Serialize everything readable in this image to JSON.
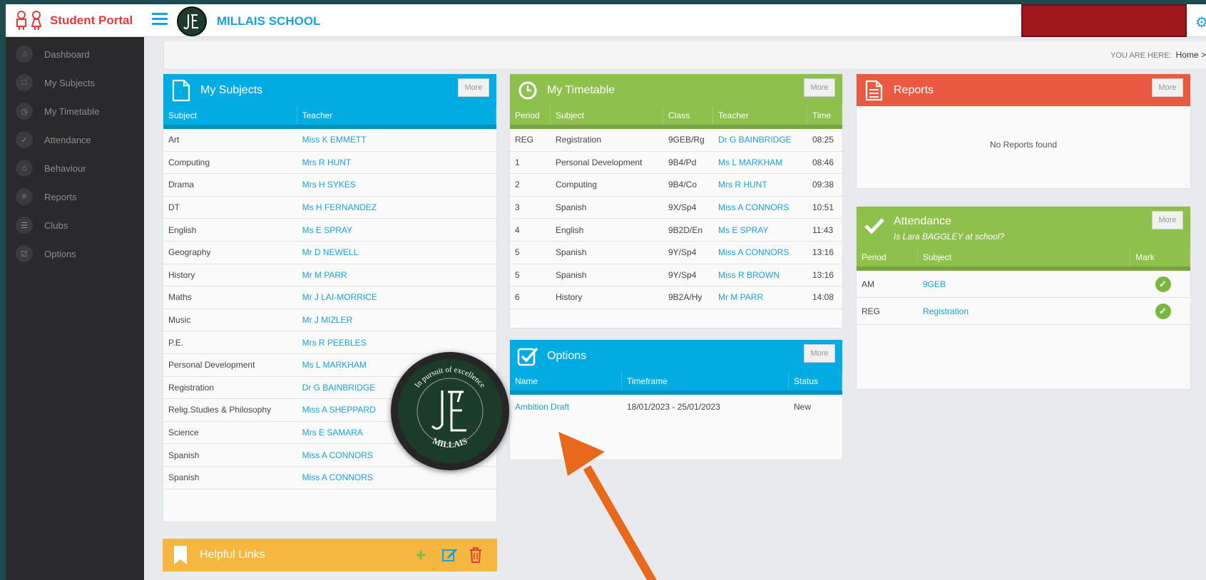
{
  "brand": {
    "title": "Student Portal"
  },
  "school": {
    "name": "MILLAIS SCHOOL"
  },
  "sidebar": {
    "items": [
      {
        "label": "Dashboard",
        "icon": "home-icon"
      },
      {
        "label": "My Subjects",
        "icon": "file-icon"
      },
      {
        "label": "My Timetable",
        "icon": "clock-icon"
      },
      {
        "label": "Attendance",
        "icon": "check-icon"
      },
      {
        "label": "Behaviour",
        "icon": "graduation-cap-icon"
      },
      {
        "label": "Reports",
        "icon": "document-icon"
      },
      {
        "label": "Clubs",
        "icon": "list-icon"
      },
      {
        "label": "Options",
        "icon": "checkbox-icon"
      }
    ]
  },
  "breadcrumb": {
    "prefix": "YOU ARE HERE:",
    "home": "Home >"
  },
  "subjects": {
    "title": "My Subjects",
    "more": "More",
    "columns": [
      "Subject",
      "Teacher"
    ],
    "rows": [
      [
        "Art",
        "Miss K EMMETT"
      ],
      [
        "Computing",
        "Mrs R HUNT"
      ],
      [
        "Drama",
        "Mrs H SYKES"
      ],
      [
        "DT",
        "Ms H FERNANDEZ"
      ],
      [
        "English",
        "Ms E SPRAY"
      ],
      [
        "Geography",
        "Mr D NEWELL"
      ],
      [
        "History",
        "Mr M PARR"
      ],
      [
        "Maths",
        "Mr J LAI-MORRICE"
      ],
      [
        "Music",
        "Mr J MIZLER"
      ],
      [
        "P.E.",
        "Mrs R PEEBLES"
      ],
      [
        "Personal Development",
        "Ms L MARKHAM"
      ],
      [
        "Registration",
        "Dr G BAINBRIDGE"
      ],
      [
        "Relig.Studies & Philosophy",
        "Miss A SHEPPARD"
      ],
      [
        "Science",
        "Mrs E SAMARA"
      ],
      [
        "Spanish",
        "Miss A CONNORS"
      ],
      [
        "Spanish",
        "Miss A CONNORS"
      ]
    ]
  },
  "timetable": {
    "title": "My Timetable",
    "more": "More",
    "columns": [
      "Period",
      "Subject",
      "Class",
      "Teacher",
      "Time"
    ],
    "rows": [
      [
        "REG",
        "Registration",
        "9GEB/Rg",
        "Dr G BAINBRIDGE",
        "08:25"
      ],
      [
        "1",
        "Personal Development",
        "9B4/Pd",
        "Ms L MARKHAM",
        "08:46"
      ],
      [
        "2",
        "Computing",
        "9B4/Co",
        "Mrs R HUNT",
        "09:38"
      ],
      [
        "3",
        "Spanish",
        "9X/Sp4",
        "Miss A CONNORS",
        "10:51"
      ],
      [
        "4",
        "English",
        "9B2D/En",
        "Ms E SPRAY",
        "11:43"
      ],
      [
        "5",
        "Spanish",
        "9Y/Sp4",
        "Miss A CONNORS",
        "13:16"
      ],
      [
        "5",
        "Spanish",
        "9Y/Sp4",
        "Miss R BROWN",
        "13:16"
      ],
      [
        "6",
        "History",
        "9B2A/Hy",
        "Mr M PARR",
        "14:08"
      ]
    ]
  },
  "options": {
    "title": "Options",
    "more": "More",
    "columns": [
      "Name",
      "Timeframe",
      "Status"
    ],
    "rows": [
      [
        "Ambition Draft",
        "18/01/2023 - 25/01/2023",
        "New"
      ]
    ]
  },
  "reports": {
    "title": "Reports",
    "more": "More",
    "empty": "No Reports found"
  },
  "attendance": {
    "title": "Attendance",
    "more": "More",
    "subtitle": "Is Lara BAGGLEY at school?",
    "columns": [
      "Period",
      "Subject",
      "Mark"
    ],
    "rows": [
      [
        "AM",
        "9GEB"
      ],
      [
        "REG",
        "Registration"
      ]
    ]
  },
  "helpful_links": {
    "title": "Helpful Links"
  },
  "badge": {
    "motto": "In pursuit of excellence",
    "name": "MILLAIS"
  },
  "colors": {
    "blue": "#00ace2",
    "green": "#8dc04c",
    "red": "#ea5a42",
    "yellow": "#f5b73f",
    "arrow": "#e8691c"
  }
}
